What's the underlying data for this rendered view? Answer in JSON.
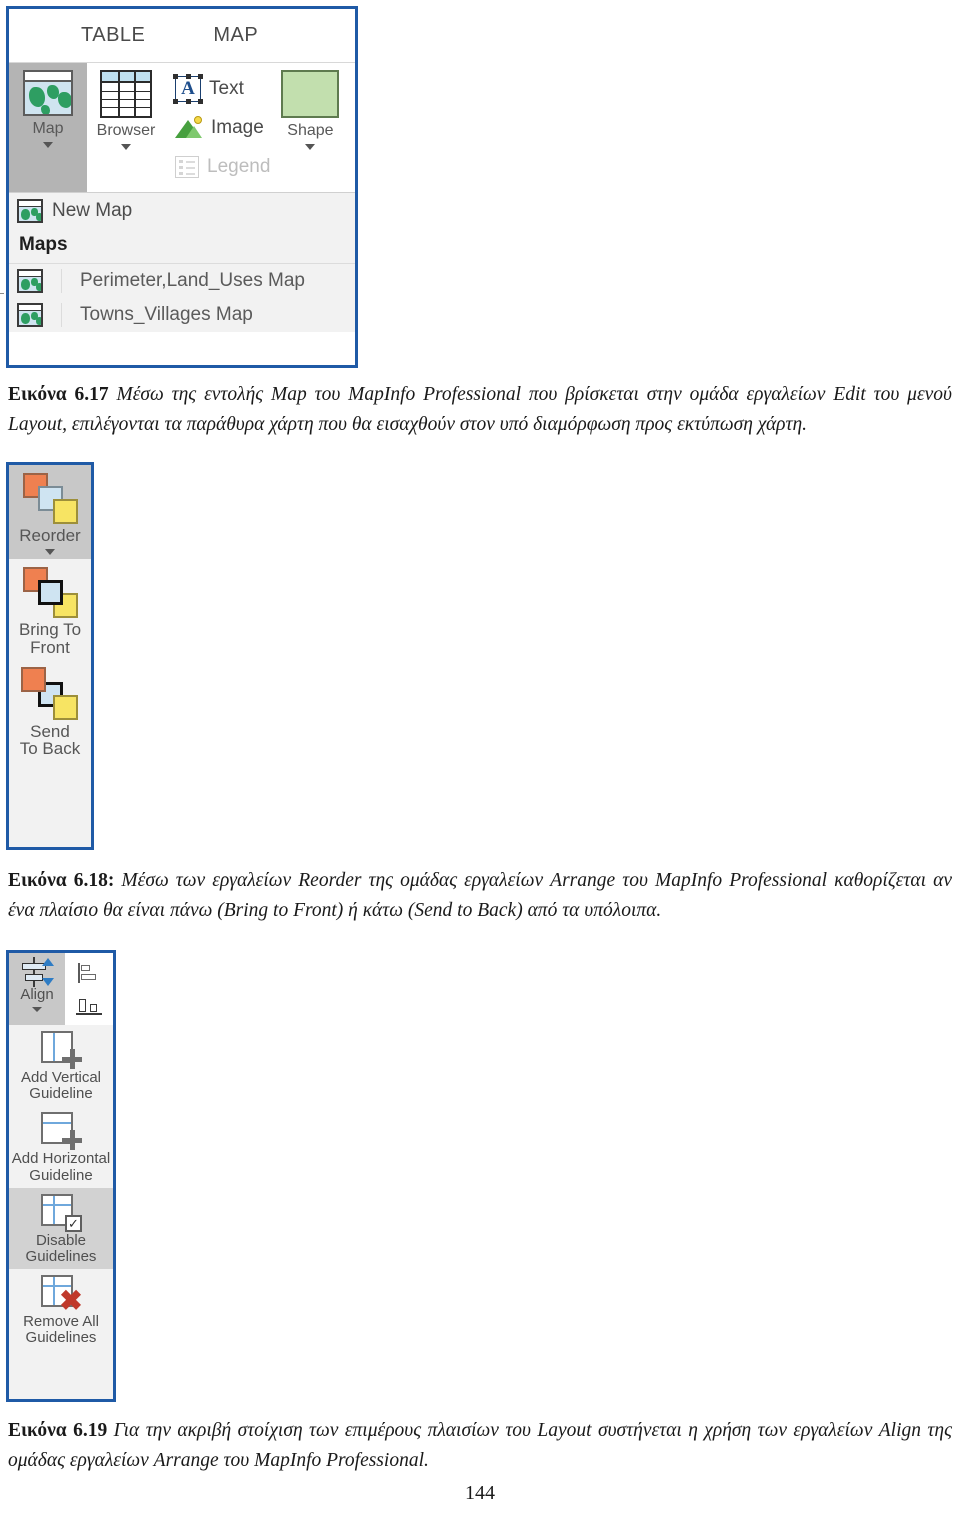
{
  "page": {
    "number": "144"
  },
  "figure_map": {
    "tabs": [
      "TABLE",
      "MAP"
    ],
    "ribbon": {
      "map_label": "Map",
      "browser_label": "Browser",
      "text_label": "Text",
      "image_label": "Image",
      "legend_label": "Legend",
      "shape_label": "Shape"
    },
    "dropdown": {
      "new_map_label": "New Map",
      "section_header": "Maps",
      "items": [
        {
          "label": "Perimeter,Land_Uses Map"
        },
        {
          "label": "Towns_Villages Map"
        }
      ]
    }
  },
  "figure_reorder": {
    "items": [
      {
        "label": "Reorder",
        "selected": true,
        "has_caret": true
      },
      {
        "label": "Bring To\nFront",
        "selected": false,
        "has_caret": false
      },
      {
        "label": "Send\nTo Back",
        "selected": false,
        "has_caret": false
      }
    ],
    "reorder_label": "Reorder",
    "bring_to_front_label": "Bring To Front",
    "send_to_back_label": "Send To Back"
  },
  "figure_align": {
    "align_label": "Align",
    "guidelines": [
      {
        "label": "Add Vertical Guideline",
        "selected": false
      },
      {
        "label": "Add Horizontal Guideline",
        "selected": false
      },
      {
        "label": "Disable Guidelines",
        "selected": true
      },
      {
        "label": "Remove All Guidelines",
        "selected": false
      }
    ],
    "add_vertical_label": "Add Vertical\nGuideline",
    "add_horizontal_label": "Add Horizontal\nGuideline",
    "disable_label": "Disable\nGuidelines",
    "remove_all_label": "Remove All\nGuidelines"
  },
  "captions": {
    "c617_number": "Εικόνα 6.17",
    "c617_text": " Μέσω της εντολής Map του MapInfo Professional που βρίσκεται στην ομάδα εργαλείων Edit του μενού Layout, επιλέγονται τα παράθυρα χάρτη που θα εισαχθούν στον υπό διαμόρφωση προς εκτύπωση χάρτη.",
    "c618_number": "Εικόνα 6.18:",
    "c618_text": " Μέσω των εργαλείων Reorder της ομάδας εργαλείων Arrange του MapInfo Professional καθορίζεται αν ένα πλαίσιο θα είναι πάνω (Bring to Front) ή κάτω (Send to Back) από τα υπόλοιπα.",
    "c619_number": "Εικόνα 6.19",
    "c619_text": " Για την ακριβή στοίχιση των επιμέρους πλαισίων του Layout συστήνεται η χρήση των εργαλείων Align της ομάδας εργαλείων Arrange του MapInfo Professional."
  },
  "colors": {
    "frame_border": "#1f5aa6",
    "selected_bg": "#c8c8c8",
    "panel_bg": "#f2f2f2",
    "sq_orange": "#ef8050",
    "sq_blue": "#cfe4f2",
    "sq_yellow": "#f7e463",
    "guide_blue": "#6fa8dc",
    "map_green": "#2e9e62",
    "shape_green": "#c2dfae"
  }
}
